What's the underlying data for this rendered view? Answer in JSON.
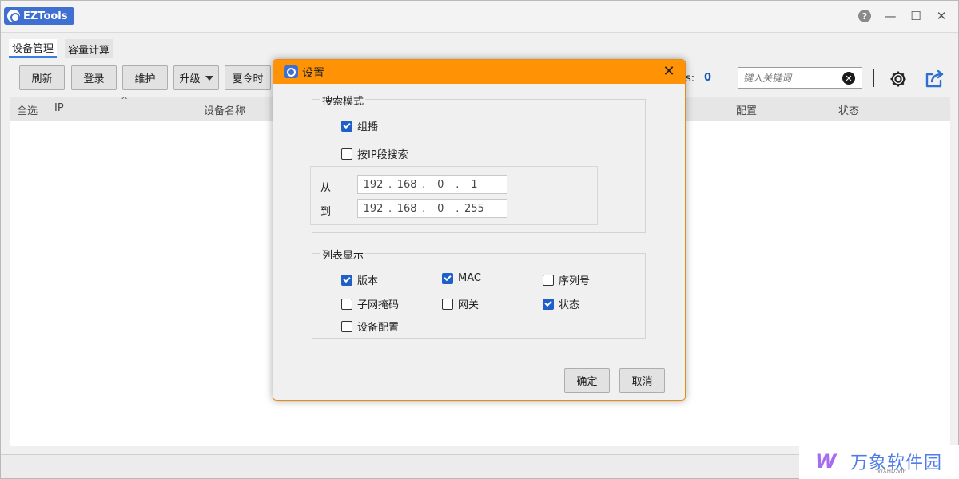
{
  "app": {
    "title": "EZTools"
  },
  "window_controls": {
    "help": "?",
    "minimize": "—",
    "maximize": "☐",
    "close": "✕"
  },
  "tabs": [
    {
      "label": "设备管理",
      "active": true
    },
    {
      "label": "容量计算",
      "active": false
    }
  ],
  "toolbar": {
    "refresh": "刷新",
    "login": "登录",
    "maintain": "维护",
    "upgrade": "升级",
    "dst": "夏令时",
    "count_label": "s:",
    "count_value": "0",
    "search_placeholder": "键入关键词",
    "clear_symbol": "✕"
  },
  "table": {
    "columns": [
      "全选",
      "IP",
      "设备名称",
      "配置",
      "状态"
    ],
    "sort_indicator": "^"
  },
  "dialog": {
    "title": "设置",
    "close_symbol": "✕",
    "search_mode": {
      "legend": "搜索模式",
      "multicast": {
        "label": "组播",
        "checked": true
      },
      "ip_segment": {
        "label": "按IP段搜索",
        "checked": false
      },
      "from_label": "从",
      "to_label": "到",
      "from_ip": [
        "192",
        "168",
        "0",
        "1"
      ],
      "to_ip": [
        "192",
        "168",
        "0",
        "255"
      ],
      "dot": "."
    },
    "list_display": {
      "legend": "列表显示",
      "items": [
        {
          "label": "版本",
          "checked": true
        },
        {
          "label": "MAC",
          "checked": true
        },
        {
          "label": "序列号",
          "checked": false
        },
        {
          "label": "子网掩码",
          "checked": false
        },
        {
          "label": "网关",
          "checked": false
        },
        {
          "label": "状态",
          "checked": true
        },
        {
          "label": "设备配置",
          "checked": false
        }
      ]
    },
    "ok": "确定",
    "cancel": "取消"
  },
  "watermark": {
    "mark": "W",
    "text": "万象软件园",
    "sub": "WXHD.VIP"
  },
  "colors": {
    "dialog_title": "#ff9305",
    "accent_blue": "#1e5fc8",
    "app_badge": "#3f6fd1"
  }
}
